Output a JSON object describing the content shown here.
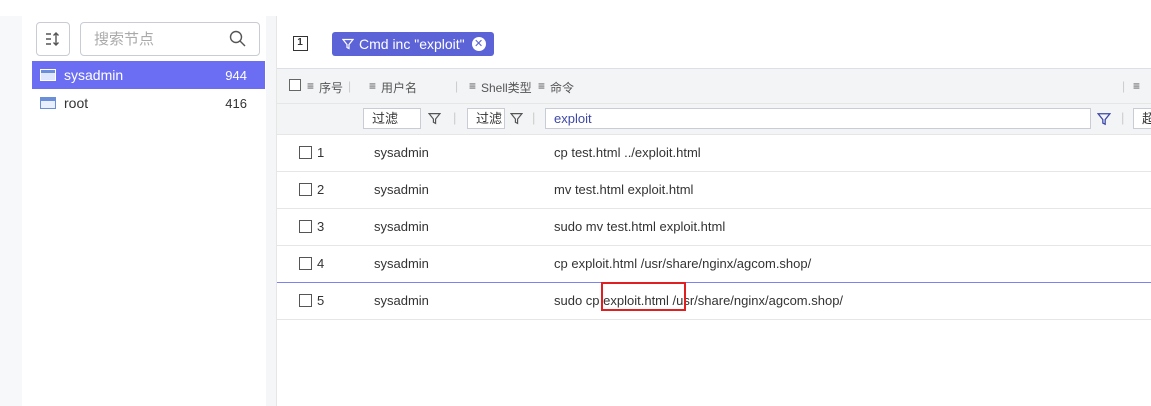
{
  "search": {
    "placeholder": "搜索节点"
  },
  "nodes": [
    {
      "name": "sysadmin",
      "count": "944"
    },
    {
      "name": "root",
      "count": "416"
    }
  ],
  "toolbar": {
    "page_indicator": "1",
    "filter_chip": "Cmd inc \"exploit\""
  },
  "columns": {
    "seq": "序号",
    "user": "用户名",
    "shell": "Shell类型",
    "cmd": "命令"
  },
  "filters": {
    "user": "过滤",
    "shell": "过滤",
    "cmd": "exploit",
    "extra": "超"
  },
  "rows": [
    {
      "seq": "1",
      "user": "sysadmin",
      "cmd": "cp test.html ../exploit.html"
    },
    {
      "seq": "2",
      "user": "sysadmin",
      "cmd": "mv test.html exploit.html"
    },
    {
      "seq": "3",
      "user": "sysadmin",
      "cmd": "sudo mv test.html exploit.html"
    },
    {
      "seq": "4",
      "user": "sysadmin",
      "cmd": "cp exploit.html /usr/share/nginx/agcom.shop/"
    },
    {
      "seq": "5",
      "user": "sysadmin",
      "cmd": "sudo cp exploit.html /usr/share/nginx/agcom.shop/"
    }
  ],
  "colors": {
    "accent": "#6b6ef2",
    "chip": "#5b63d6",
    "highlight": "#e02020"
  }
}
